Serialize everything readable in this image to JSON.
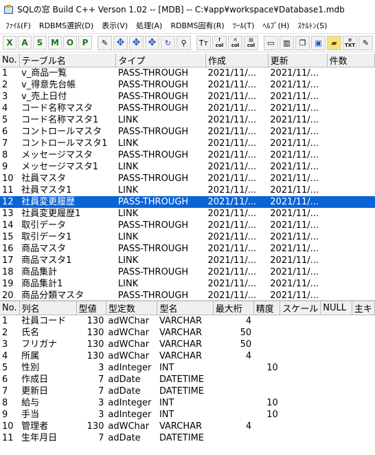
{
  "window": {
    "title": "SQLの窓 Build C++ Verson 1.02 -- [MDB] -- C:¥app¥workspace¥Database1.mdb"
  },
  "menu": [
    "ﾌｧｲﾙ(F)",
    "RDBMS選択(D)",
    "表示(V)",
    "処理(A)",
    "RDBMS固有(R)",
    "ﾂｰﾙ(T)",
    "ﾍﾙﾌﾟ(H)",
    "ｽｹﾙﾄﾝ(S)"
  ],
  "toolbar": {
    "letters": [
      "X",
      "A",
      "S",
      "M",
      "O",
      "P"
    ],
    "col_label": "col",
    "txt_label": "TXT"
  },
  "tables_grid": {
    "headers": [
      "No.",
      "テーブル名",
      "タイプ",
      "作成",
      "更新",
      "件数"
    ],
    "selected_row": 11,
    "rows": [
      [
        "1",
        "v_商品一覧",
        "PASS-THROUGH",
        "2021/11/...",
        "2021/11/...",
        ""
      ],
      [
        "2",
        "v_得意先台帳",
        "PASS-THROUGH",
        "2021/11/...",
        "2021/11/...",
        ""
      ],
      [
        "3",
        "v_売上日付",
        "PASS-THROUGH",
        "2021/11/...",
        "2021/11/...",
        ""
      ],
      [
        "4",
        "コード名称マスタ",
        "PASS-THROUGH",
        "2021/11/...",
        "2021/11/...",
        ""
      ],
      [
        "5",
        "コード名称マスタ1",
        "LINK",
        "2021/11/...",
        "2021/11/...",
        ""
      ],
      [
        "6",
        "コントロールマスタ",
        "PASS-THROUGH",
        "2021/11/...",
        "2021/11/...",
        ""
      ],
      [
        "7",
        "コントロールマスタ1",
        "LINK",
        "2021/11/...",
        "2021/11/...",
        ""
      ],
      [
        "8",
        "メッセージマスタ",
        "PASS-THROUGH",
        "2021/11/...",
        "2021/11/...",
        ""
      ],
      [
        "9",
        "メッセージマスタ1",
        "LINK",
        "2021/11/...",
        "2021/11/...",
        ""
      ],
      [
        "10",
        "社員マスタ",
        "PASS-THROUGH",
        "2021/11/...",
        "2021/11/...",
        ""
      ],
      [
        "11",
        "社員マスタ1",
        "LINK",
        "2021/11/...",
        "2021/11/...",
        ""
      ],
      [
        "12",
        "社員変更履歴",
        "PASS-THROUGH",
        "2021/11/...",
        "2021/11/...",
        ""
      ],
      [
        "13",
        "社員変更履歴1",
        "LINK",
        "2021/11/...",
        "2021/11/...",
        ""
      ],
      [
        "14",
        "取引データ",
        "PASS-THROUGH",
        "2021/11/...",
        "2021/11/...",
        ""
      ],
      [
        "15",
        "取引データ1",
        "LINK",
        "2021/11/...",
        "2021/11/...",
        ""
      ],
      [
        "16",
        "商品マスタ",
        "PASS-THROUGH",
        "2021/11/...",
        "2021/11/...",
        ""
      ],
      [
        "17",
        "商品マスタ1",
        "LINK",
        "2021/11/...",
        "2021/11/...",
        ""
      ],
      [
        "18",
        "商品集計",
        "PASS-THROUGH",
        "2021/11/...",
        "2021/11/...",
        ""
      ],
      [
        "19",
        "商品集計1",
        "LINK",
        "2021/11/...",
        "2021/11/...",
        ""
      ],
      [
        "20",
        "商品分類マスタ",
        "PASS-THROUGH",
        "2021/11/...",
        "2021/11/...",
        ""
      ]
    ]
  },
  "columns_grid": {
    "headers": [
      "No.",
      "列名",
      "型値",
      "型定数",
      "型名",
      "最大桁",
      "精度",
      "スケール",
      "NULL",
      "主キ"
    ],
    "rows": [
      [
        "1",
        "社員コード",
        "130",
        "adWChar",
        "VARCHAR",
        "4",
        "",
        "",
        "",
        ""
      ],
      [
        "2",
        "氏名",
        "130",
        "adWChar",
        "VARCHAR",
        "50",
        "",
        "",
        "",
        ""
      ],
      [
        "3",
        "フリガナ",
        "130",
        "adWChar",
        "VARCHAR",
        "50",
        "",
        "",
        "",
        ""
      ],
      [
        "4",
        "所属",
        "130",
        "adWChar",
        "VARCHAR",
        "4",
        "",
        "",
        "",
        ""
      ],
      [
        "5",
        "性別",
        "3",
        "adInteger",
        "INT",
        "",
        "10",
        "",
        "",
        ""
      ],
      [
        "6",
        "作成日",
        "7",
        "adDate",
        "DATETIME",
        "",
        "",
        "",
        "",
        ""
      ],
      [
        "7",
        "更新日",
        "7",
        "adDate",
        "DATETIME",
        "",
        "",
        "",
        "",
        ""
      ],
      [
        "8",
        "給与",
        "3",
        "adInteger",
        "INT",
        "",
        "10",
        "",
        "",
        ""
      ],
      [
        "9",
        "手当",
        "3",
        "adInteger",
        "INT",
        "",
        "10",
        "",
        "",
        ""
      ],
      [
        "10",
        "管理者",
        "130",
        "adWChar",
        "VARCHAR",
        "4",
        "",
        "",
        "",
        ""
      ],
      [
        "11",
        "生年月日",
        "7",
        "adDate",
        "DATETIME",
        "",
        "",
        "",
        "",
        ""
      ]
    ]
  },
  "colors": {
    "selection": "#0a64d6",
    "letter_buttons": "#1b7a1b"
  }
}
